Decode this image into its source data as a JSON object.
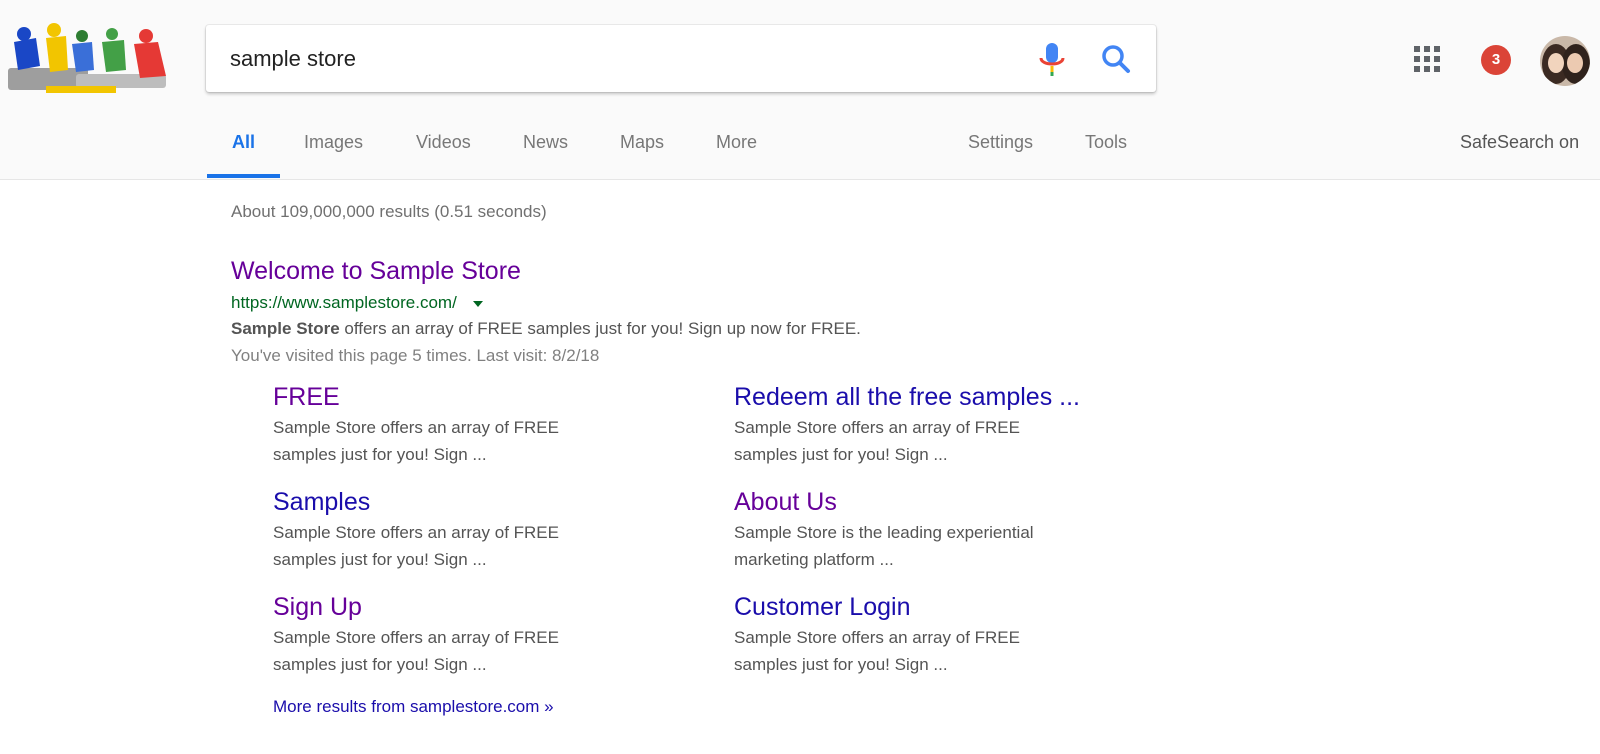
{
  "search": {
    "query": "sample store"
  },
  "header": {
    "notification_count": "3"
  },
  "tabs": [
    "All",
    "Images",
    "Videos",
    "News",
    "Maps",
    "More"
  ],
  "tools": {
    "settings": "Settings",
    "tools": "Tools"
  },
  "safesearch": "SafeSearch on",
  "stats": "About 109,000,000 results (0.51 seconds)",
  "result": {
    "title": "Welcome to Sample Store",
    "url": "https://www.samplestore.com/",
    "snippet_bold": "Sample Store",
    "snippet_rest": " offers an array of FREE samples just for you! Sign up now for FREE.",
    "visited": "You've visited this page 5 times. Last visit: 8/2/18"
  },
  "sitelinks": [
    {
      "title": "FREE",
      "desc": "Sample Store offers an array of FREE samples just for you! Sign ..."
    },
    {
      "title": "Redeem all the free samples ...",
      "desc": "Sample Store offers an array of FREE samples just for you! Sign ..."
    },
    {
      "title": "Samples",
      "desc": "Sample Store offers an array of FREE samples just for you! Sign ..."
    },
    {
      "title": "About Us",
      "desc": "Sample Store is the leading experiential marketing platform ..."
    },
    {
      "title": "Sign Up",
      "desc": "Sample Store offers an array of FREE samples just for you! Sign ..."
    },
    {
      "title": "Customer Login",
      "desc": "Sample Store offers an array of FREE samples just for you! Sign ..."
    }
  ],
  "more_results": "More results from samplestore.com »",
  "colors": {
    "accent": "#1a73e8",
    "visited_link": "#660099",
    "link": "#1a0dab",
    "url_green": "#006621",
    "badge_red": "#db4437"
  },
  "icons": {
    "mic": "mic-icon",
    "search": "search-icon",
    "apps": "apps-grid-icon",
    "dropdown": "dropdown-caret-icon"
  }
}
